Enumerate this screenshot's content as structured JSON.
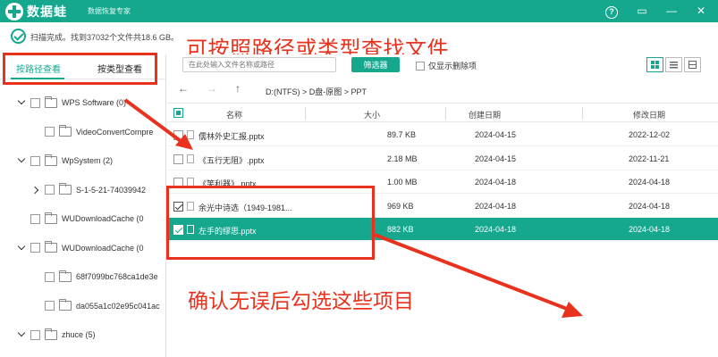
{
  "titlebar": {
    "app_name": "数据蛙",
    "subtitle": "数据恢复专家",
    "help_icon": "?",
    "restore_icon": "▭",
    "minimize_icon": "—",
    "close_icon": "✕"
  },
  "status": {
    "text": "扫描完成。找到37032个文件共18.6 GB。"
  },
  "annotations": {
    "top": "可按照路径或类型查找文件",
    "bottom": "确认无误后勾选这些项目"
  },
  "tabs": {
    "path": "按路径查看",
    "type": "按类型查看"
  },
  "tree": [
    {
      "label": "WPS Software (0)",
      "caret": "down",
      "level": 1
    },
    {
      "label": "VideoConvertCompre",
      "caret": "none",
      "level": 2
    },
    {
      "label": "WpSystem (2)",
      "caret": "down",
      "level": 1
    },
    {
      "label": "S-1-5-21-74039942",
      "caret": "right",
      "level": 2
    },
    {
      "label": "WUDownloadCache (0",
      "caret": "none",
      "level": 1
    },
    {
      "label": "WUDownloadCache (0",
      "caret": "down",
      "level": 1
    },
    {
      "label": "68f7099bc768ca1de3e",
      "caret": "none",
      "level": 2
    },
    {
      "label": "da055a1c02e95c041ac",
      "caret": "none",
      "level": 2
    },
    {
      "label": "zhuce (5)",
      "caret": "down",
      "level": 1
    }
  ],
  "toolbar": {
    "search_placeholder": "在此处输入文件名称或路径",
    "filter_label": "筛选器",
    "only_deleted_label": "仅显示删除项"
  },
  "nav": {
    "back_icon": "←",
    "forward_icon": "→",
    "up_icon": "↑",
    "path": "D:(NTFS)  >  D盘-原图  >  PPT"
  },
  "table": {
    "headers": {
      "name": "名称",
      "size": "大小",
      "created": "创建日期",
      "modified": "修改日期"
    },
    "rows": [
      {
        "name": "儒林外史汇报.pptx",
        "size": "89.7 KB",
        "created": "2024-04-15",
        "modified": "2022-12-02",
        "checked": false,
        "selected": false
      },
      {
        "name": "《五行无阻》.pptx",
        "size": "2.18 MB",
        "created": "2024-04-15",
        "modified": "2022-11-21",
        "checked": false,
        "selected": false
      },
      {
        "name": "《笑利器》.pptx",
        "size": "1.00 MB",
        "created": "2024-04-18",
        "modified": "2024-04-18",
        "checked": false,
        "selected": false
      },
      {
        "name": "余光中诗选（1949-1981...",
        "size": "969 KB",
        "created": "2024-04-18",
        "modified": "2024-04-18",
        "checked": true,
        "selected": false
      },
      {
        "name": "左手的缪思.pptx",
        "size": "882 KB",
        "created": "2024-04-18",
        "modified": "2024-04-18",
        "checked": true,
        "selected": true
      }
    ]
  },
  "colors": {
    "accent": "#15a88f",
    "annotation_red": "#e8321e"
  }
}
